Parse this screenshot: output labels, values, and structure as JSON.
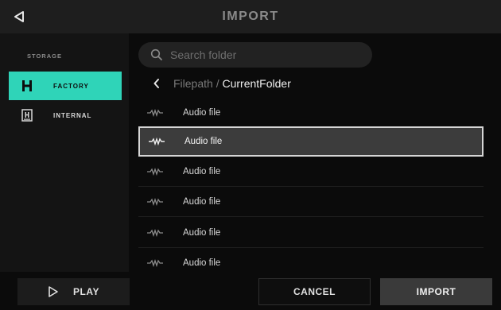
{
  "header": {
    "title": "IMPORT",
    "back_icon": "back-triangle-icon"
  },
  "sidebar": {
    "section_label": "STORAGE",
    "items": [
      {
        "label": "FACTORY",
        "icon": "factory-h-icon",
        "active": true
      },
      {
        "label": "INTERNAL",
        "icon": "internal-storage-icon",
        "active": false
      }
    ]
  },
  "search": {
    "placeholder": "Search folder"
  },
  "path": {
    "parent": "Filepath",
    "separator": " / ",
    "current": "CurrentFolder"
  },
  "files": [
    {
      "name": "Audio file"
    },
    {
      "name": "Audio file",
      "selected": true
    },
    {
      "name": "Audio file"
    },
    {
      "name": "Audio file"
    },
    {
      "name": "Audio file"
    },
    {
      "name": "Audio file"
    }
  ],
  "footer": {
    "play_label": "PLAY",
    "cancel_label": "CANCEL",
    "import_label": "IMPORT"
  },
  "colors": {
    "accent": "#2fd4b8",
    "background": "#0b0b0b",
    "header": "#1e1e1e",
    "selected_row": "#3c3c3c"
  }
}
